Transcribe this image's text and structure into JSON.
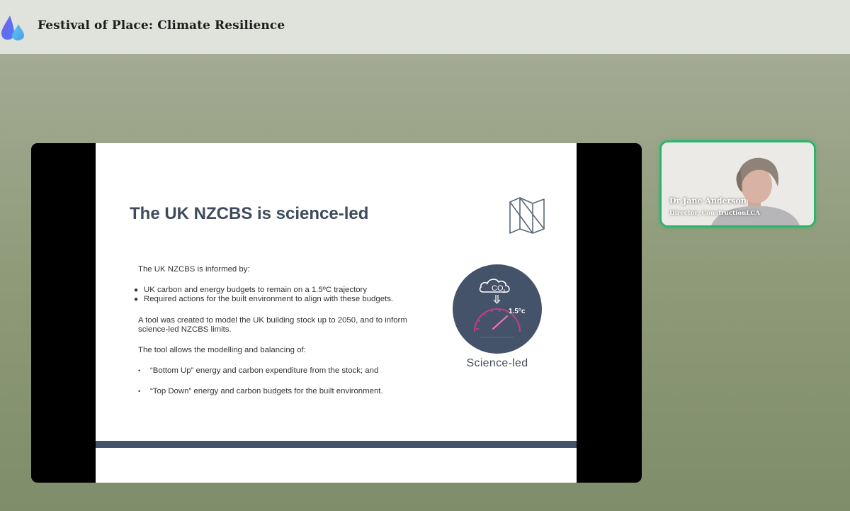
{
  "header": {
    "app_logo_icon": "droplet-logo-icon",
    "event_title": "Festival of Place: Climate Resilience"
  },
  "slide": {
    "title": "The UK NZCBS is science-led",
    "intro": "The UK NZCBS is informed by:",
    "bullets_primary": [
      "UK carbon and energy budgets to remain on a 1.5ºC trajectory",
      "Required actions for the built environment to align with these budgets."
    ],
    "tool_para_line1": "A tool was created to model the UK building stock up to 2050, and to inform",
    "tool_para_line2": "science-led NZCBS limits.",
    "tool_allows": "The tool allows the modelling and balancing of:",
    "bullets_secondary": [
      "“Bottom Up” energy and carbon expenditure from the stock; and",
      "“Top Down” energy and carbon budgets for the built environment."
    ],
    "graphic": {
      "co2_label": "CO",
      "co2_sub": "2",
      "temp_label": "1.5°c",
      "caption": "Science-led"
    }
  },
  "speaker": {
    "name": "Dr Jane Anderson",
    "role": "Director, ConstructionLCA"
  },
  "colors": {
    "header_bg": "#e0e2dc",
    "slide_title": "#3f4b5c",
    "circle_fill": "#45536a",
    "gauge_accent": "#c13f8a",
    "speaker_border": "#2fb36a"
  }
}
